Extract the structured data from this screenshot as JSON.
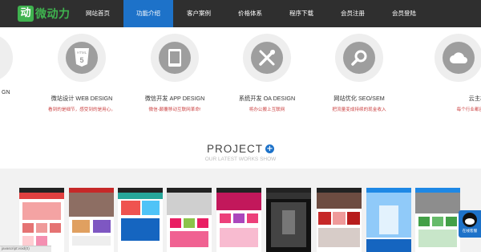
{
  "header": {
    "logo_mark": "动",
    "logo_text": "微动力",
    "nav": [
      {
        "label": "网站首页"
      },
      {
        "label": "功能介绍",
        "active": true
      },
      {
        "label": "客户案例"
      },
      {
        "label": "价格体系"
      },
      {
        "label": "程序下载"
      },
      {
        "label": "会员注册"
      },
      {
        "label": "会员登陆"
      }
    ],
    "colors": {
      "bar": "#2f2f2f",
      "active": "#1d72c9",
      "logo": "#3fb34f"
    }
  },
  "services": {
    "left_edge_text": "GN",
    "items": [
      {
        "title": "微站设计 WEB DESIGN",
        "desc": "看到的是细节，感受到的是用心。",
        "icon": "html5-icon"
      },
      {
        "title": "微信开发 APP DESIGN",
        "desc": "微信-颠覆移动互联网革命!",
        "icon": "tablet-icon"
      },
      {
        "title": "系统开发 OA DESIGN",
        "desc": "将办公搬上互联网",
        "icon": "tools-icon"
      },
      {
        "title": "网站优化 SEO/SEM",
        "desc": "把流量变成持续的现金收入",
        "icon": "search-icon"
      },
      {
        "title": "云主机 ID",
        "desc": "每个行业都应该有",
        "icon": "cloud-icon"
      }
    ]
  },
  "project": {
    "title": "PROJECT",
    "plus": "+",
    "subtitle": "OUR LATEST WORKS SHOW"
  },
  "gallery": {
    "count": 9
  },
  "widget": {
    "label": "在线客服"
  },
  "status": {
    "text": "javascript:void(0)"
  }
}
